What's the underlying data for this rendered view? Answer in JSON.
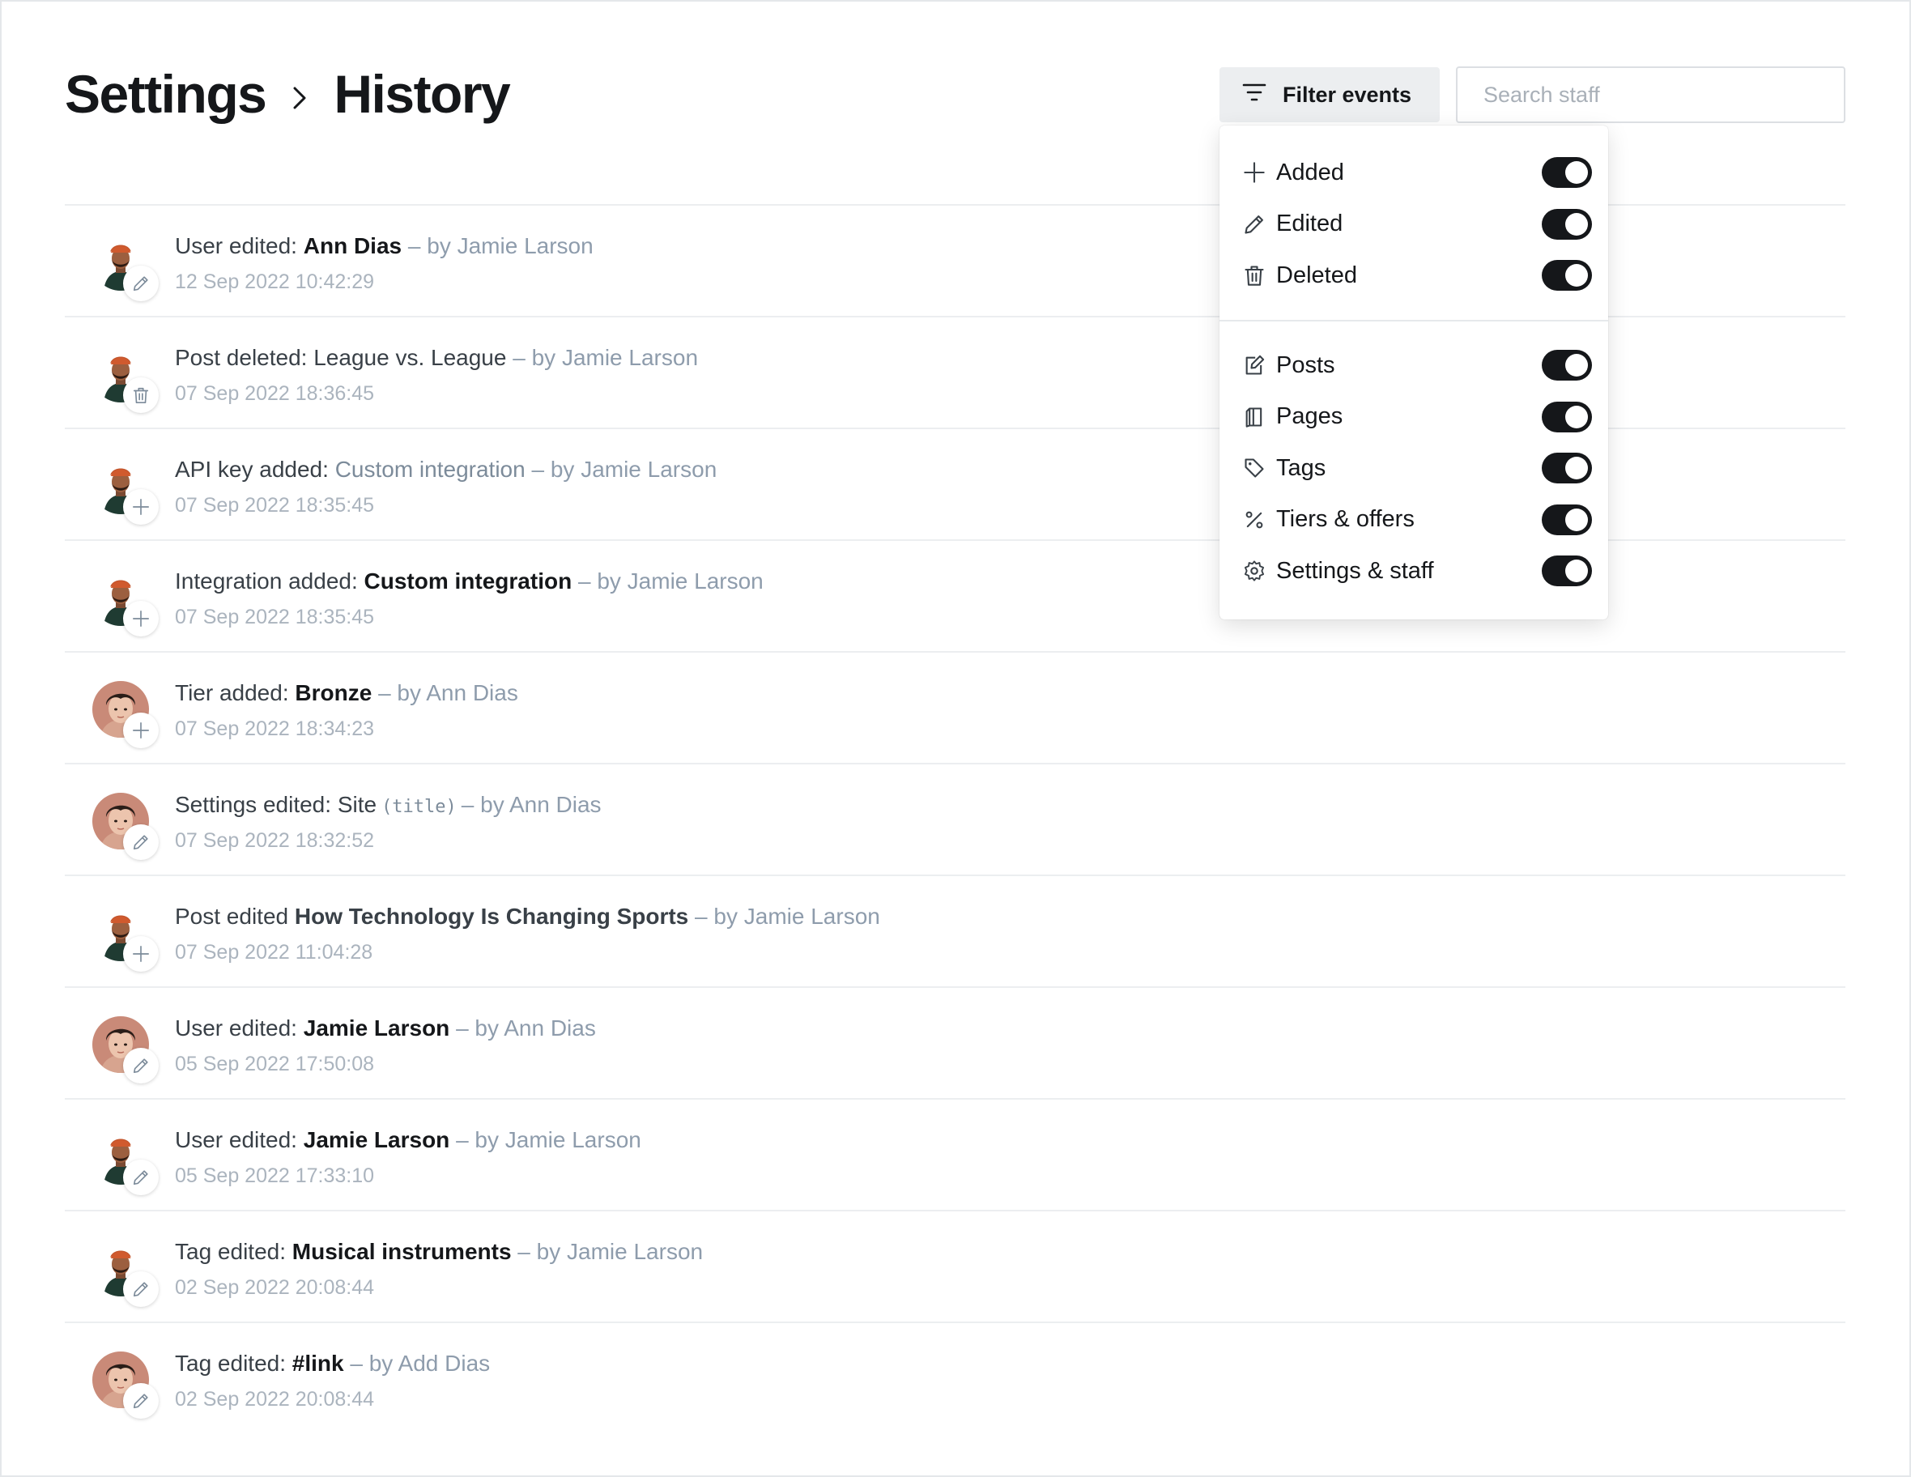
{
  "header": {
    "breadcrumb_root": "Settings",
    "breadcrumb_current": "History"
  },
  "toolbar": {
    "filter_label": "Filter events",
    "search_placeholder": "Search staff"
  },
  "filter_menu": {
    "actions": [
      {
        "label": "Added",
        "icon": "plus-icon",
        "enabled": true
      },
      {
        "label": "Edited",
        "icon": "pencil-icon",
        "enabled": true
      },
      {
        "label": "Deleted",
        "icon": "trash-icon",
        "enabled": true
      }
    ],
    "resources": [
      {
        "label": "Posts",
        "icon": "post-edit-icon",
        "enabled": true
      },
      {
        "label": "Pages",
        "icon": "page-icon",
        "enabled": true
      },
      {
        "label": "Tags",
        "icon": "tag-icon",
        "enabled": true
      },
      {
        "label": "Tiers & offers",
        "icon": "percent-icon",
        "enabled": true
      },
      {
        "label": "Settings & staff",
        "icon": "gear-icon",
        "enabled": true
      }
    ]
  },
  "events": [
    {
      "action": "User edited: ",
      "object": "Ann Dias",
      "object_style": "bold",
      "code": "",
      "by": "– by Jamie Larson",
      "time": "12 Sep 2022 10:42:29",
      "avatar": "jamie",
      "badge": "pencil-icon"
    },
    {
      "action": "Post deleted: ",
      "object": "League vs. League",
      "object_style": "plain",
      "code": "",
      "by": "– by Jamie Larson",
      "time": "07 Sep 2022 18:36:45",
      "avatar": "jamie",
      "badge": "trash-icon"
    },
    {
      "action": "API key added: ",
      "object": "Custom integration",
      "object_style": "link",
      "code": "",
      "by": "– by Jamie Larson",
      "time": "07 Sep 2022 18:35:45",
      "avatar": "jamie",
      "badge": "plus-icon"
    },
    {
      "action": "Integration added: ",
      "object": "Custom integration",
      "object_style": "bold",
      "code": "",
      "by": "– by Jamie Larson",
      "time": "07 Sep 2022 18:35:45",
      "avatar": "jamie",
      "badge": "plus-icon"
    },
    {
      "action": "Tier added: ",
      "object": "Bronze",
      "object_style": "bold",
      "code": "",
      "by": "– by Ann Dias",
      "time": "07 Sep 2022 18:34:23",
      "avatar": "ann",
      "badge": "plus-icon"
    },
    {
      "action": "Settings edited: ",
      "object": "Site",
      "object_style": "plain",
      "code": "(title)",
      "by": "– by Ann Dias",
      "time": "07 Sep 2022 18:32:52",
      "avatar": "ann",
      "badge": "pencil-icon"
    },
    {
      "action": "Post edited ",
      "object": "How Technology Is Changing Sports",
      "object_style": "semi",
      "code": "",
      "by": "– by Jamie Larson",
      "time": "07 Sep 2022 11:04:28",
      "avatar": "jamie",
      "badge": "plus-icon"
    },
    {
      "action": "User edited: ",
      "object": "Jamie Larson",
      "object_style": "bold",
      "code": "",
      "by": "– by Ann Dias",
      "time": "05 Sep 2022 17:50:08",
      "avatar": "ann",
      "badge": "pencil-icon"
    },
    {
      "action": "User edited: ",
      "object": "Jamie Larson",
      "object_style": "bold",
      "code": "",
      "by": "– by Jamie Larson",
      "time": "05 Sep 2022 17:33:10",
      "avatar": "jamie",
      "badge": "pencil-icon"
    },
    {
      "action": "Tag edited: ",
      "object": "Musical instruments",
      "object_style": "bold",
      "code": "",
      "by": "– by Jamie Larson",
      "time": "02 Sep 2022 20:08:44",
      "avatar": "jamie",
      "badge": "pencil-icon"
    },
    {
      "action": "Tag edited: ",
      "object": "#link",
      "object_style": "bold",
      "code": "",
      "by": "– by Add Dias",
      "time": "02 Sep 2022 20:08:44",
      "avatar": "ann",
      "badge": "pencil-icon"
    }
  ],
  "colors": {
    "text_primary": "#15171a",
    "text_muted": "#8e9cac",
    "toggle_on": "#15171a",
    "divider": "#eceef0"
  }
}
